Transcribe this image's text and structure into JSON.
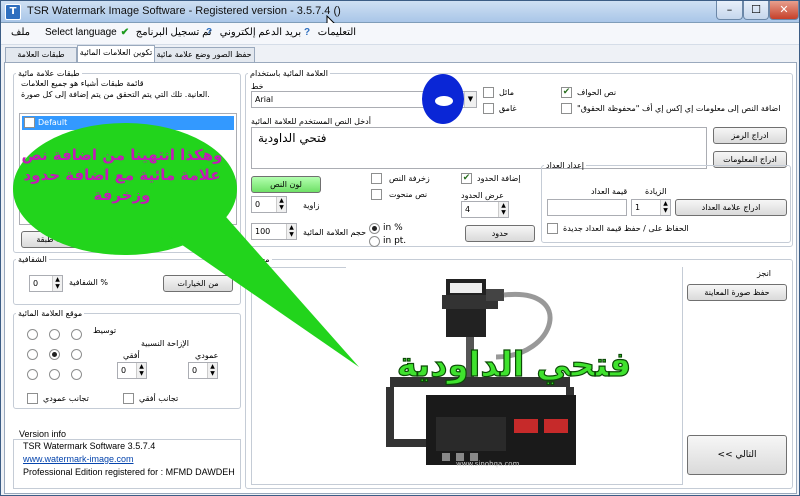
{
  "window": {
    "title": "TSR Watermark Image Software - Registered version - 3.5.7.4 ()",
    "min": "–",
    "max": "☐",
    "close": "✕"
  },
  "menu": {
    "items": [
      {
        "label": "التعليمات",
        "icon": "?"
      },
      {
        "label": "بريد الدعم إلكتروني",
        "icon": "?"
      },
      {
        "label": "تم تسجيل البرنامج",
        "icon": "✔"
      },
      {
        "label": "Select language",
        "icon": ""
      },
      {
        "label": "ملف",
        "icon": ""
      }
    ]
  },
  "tabs": [
    "حفظ الصور وضع علامة مائية كما",
    "تكوين العلامات المائية",
    "طبقات العلامة المائية"
  ],
  "layers": {
    "title": "طبقات علامة مائية",
    "desc1": "قائمة طبقات أشياء هو جميع العلامات",
    "desc2": "العانية. تلك التي يتم التحقق من يتم إضافة إلى كل صورة.",
    "default_item": "Default",
    "add_layer": "إضافة طبقة"
  },
  "callout": {
    "text": "وهكذا انتهينا من اضافة نص علامة مائية مع اضافة حدود وزخرفة"
  },
  "transparency": {
    "title": "الشفافية",
    "label": "الشفافية %",
    "value": "0",
    "options_button": "من الخيارات"
  },
  "position": {
    "title": "موقع العلامة المائية",
    "center_label": "توسيط",
    "relative_offset": "الإزاحة النسبية",
    "horizontal": "أفقي",
    "vertical": "عمودي",
    "h_value": "0",
    "v_value": "0",
    "mirror_h": "تجانب أفقي",
    "mirror_v": "تجانب عمودي"
  },
  "version": {
    "title": "Version info",
    "line1": "TSR Watermark Software 3.5.7.4",
    "link": "www.watermark-image.com",
    "line3": "Professional Edition registered for : MFMD DAWDEH"
  },
  "watermark_text": {
    "group_title": "العلامة المائية باستخدام",
    "font_label": "خط",
    "font_value": "Arial",
    "italic": "مائل",
    "bold": "غامق",
    "edge_text": "نص الحواف",
    "copyright_hint": "\"اضافة النص إلى معلومات إي إكس إي أف \"محفوظة الحقوق",
    "enter_text_label": "أدخل النص المستخدم للعلامة المائية",
    "text_value": "فتحي الداودية",
    "insert_symbol": "ادراج الرمز",
    "insert_info": "ادراج المعلومات",
    "text_color": "لون النص",
    "angle_label": "زاوية",
    "angle_value": "0",
    "size_label": "حجم العلامة المائية",
    "size_value": "100",
    "in_percent": "in %",
    "in_pt": "in pt.",
    "decorate": "زخرفة النص",
    "carved": "نص منحوت",
    "add_border": "إضافة الحدود",
    "border_width": "عرض الحدود",
    "border_value": "4",
    "border_btn": "حدود"
  },
  "counter": {
    "title": "إعداد العداد",
    "counter_value_label": "قيمة العداد",
    "increment_label": "الزيادة",
    "increment_value": "1",
    "insert_counter": "ادراج علامة العداد",
    "keep_new": "الحفاظ على / حفظ قيمة العداد جديدة"
  },
  "preview": {
    "title": "معاينة",
    "ready": "انجز",
    "save_preview": "حفظ صورة المعاينة",
    "next": "<< التالي",
    "overlay_text": "فتحي الداودية"
  },
  "colors": {
    "accent": "#2f6fbf",
    "callout_fill": "#22d41c",
    "callout_text": "#c31ab8",
    "overlay_green": "#3fe22e",
    "annotation_blue": "#0a26d6"
  }
}
